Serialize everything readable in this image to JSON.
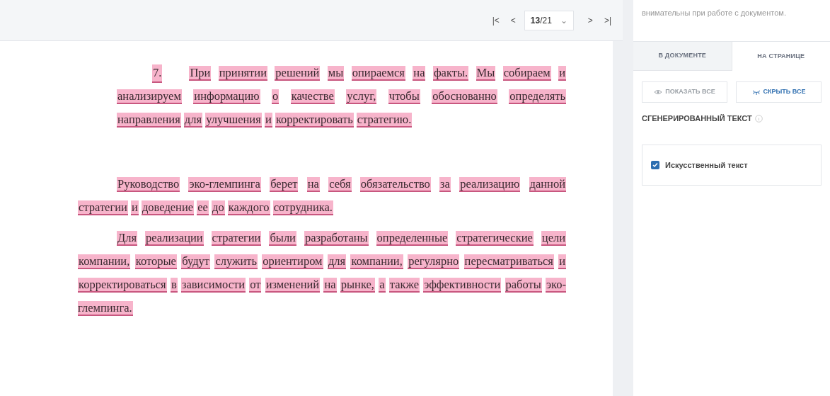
{
  "pager": {
    "first": "|<",
    "prev": "<",
    "page": "**13**/21",
    "dropdown": "⌄",
    "next": ">",
    "last": ">|"
  },
  "document": {
    "paragraphs": [
      {
        "kind": "numbered",
        "number": "7.",
        "highlighted": true,
        "text": "При принятии решений мы опираемся на факты. Мы собираем и анализируем информацию о качестве услуг, чтобы обоснованно определять направления для улучшения и корректировать стратегию."
      },
      {
        "kind": "body",
        "highlighted": true,
        "text": "Руководство эко-глемпинга берет на себя обязательство за реализацию данной стратегии и доведение ее до каждого сотрудника."
      },
      {
        "kind": "body",
        "highlighted": true,
        "text": "Для реализации стратегии были разработаны определенные стратегические цели компании, которые будут служить ориентиром для компании, регулярно пересматриваться и корректироваться в зависимости от изменений на рынке, а также эффективности работы эко-глемпинга."
      }
    ]
  },
  "sidebar": {
    "note": "внимательны при работе с документом.",
    "tabs": [
      {
        "label": "В ДОКУМЕНТЕ",
        "selected": false
      },
      {
        "label": "НА СТРАНИЦЕ",
        "selected": true
      }
    ],
    "buttons": [
      {
        "kind": "show",
        "label": "ПОКАЗАТЬ ВСЕ"
      },
      {
        "kind": "hide",
        "label": "СКРЫТЬ ВСЕ"
      }
    ],
    "section_title": "СГЕНЕРИРОВАННЫЙ ТЕКСТ",
    "options": [
      {
        "label": "Искусственный текст",
        "checked": true
      }
    ]
  }
}
